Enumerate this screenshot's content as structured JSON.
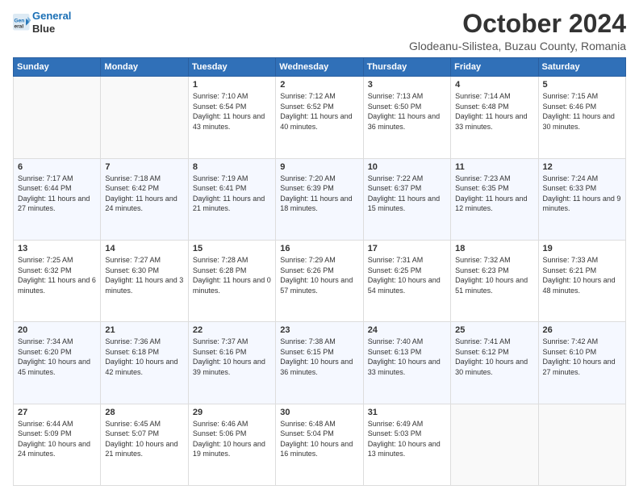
{
  "logo": {
    "line1": "General",
    "line2": "Blue"
  },
  "title": "October 2024",
  "location": "Glodeanu-Silistea, Buzau County, Romania",
  "days_of_week": [
    "Sunday",
    "Monday",
    "Tuesday",
    "Wednesday",
    "Thursday",
    "Friday",
    "Saturday"
  ],
  "weeks": [
    [
      {
        "day": "",
        "sunrise": "",
        "sunset": "",
        "daylight": ""
      },
      {
        "day": "",
        "sunrise": "",
        "sunset": "",
        "daylight": ""
      },
      {
        "day": "1",
        "sunrise": "Sunrise: 7:10 AM",
        "sunset": "Sunset: 6:54 PM",
        "daylight": "Daylight: 11 hours and 43 minutes."
      },
      {
        "day": "2",
        "sunrise": "Sunrise: 7:12 AM",
        "sunset": "Sunset: 6:52 PM",
        "daylight": "Daylight: 11 hours and 40 minutes."
      },
      {
        "day": "3",
        "sunrise": "Sunrise: 7:13 AM",
        "sunset": "Sunset: 6:50 PM",
        "daylight": "Daylight: 11 hours and 36 minutes."
      },
      {
        "day": "4",
        "sunrise": "Sunrise: 7:14 AM",
        "sunset": "Sunset: 6:48 PM",
        "daylight": "Daylight: 11 hours and 33 minutes."
      },
      {
        "day": "5",
        "sunrise": "Sunrise: 7:15 AM",
        "sunset": "Sunset: 6:46 PM",
        "daylight": "Daylight: 11 hours and 30 minutes."
      }
    ],
    [
      {
        "day": "6",
        "sunrise": "Sunrise: 7:17 AM",
        "sunset": "Sunset: 6:44 PM",
        "daylight": "Daylight: 11 hours and 27 minutes."
      },
      {
        "day": "7",
        "sunrise": "Sunrise: 7:18 AM",
        "sunset": "Sunset: 6:42 PM",
        "daylight": "Daylight: 11 hours and 24 minutes."
      },
      {
        "day": "8",
        "sunrise": "Sunrise: 7:19 AM",
        "sunset": "Sunset: 6:41 PM",
        "daylight": "Daylight: 11 hours and 21 minutes."
      },
      {
        "day": "9",
        "sunrise": "Sunrise: 7:20 AM",
        "sunset": "Sunset: 6:39 PM",
        "daylight": "Daylight: 11 hours and 18 minutes."
      },
      {
        "day": "10",
        "sunrise": "Sunrise: 7:22 AM",
        "sunset": "Sunset: 6:37 PM",
        "daylight": "Daylight: 11 hours and 15 minutes."
      },
      {
        "day": "11",
        "sunrise": "Sunrise: 7:23 AM",
        "sunset": "Sunset: 6:35 PM",
        "daylight": "Daylight: 11 hours and 12 minutes."
      },
      {
        "day": "12",
        "sunrise": "Sunrise: 7:24 AM",
        "sunset": "Sunset: 6:33 PM",
        "daylight": "Daylight: 11 hours and 9 minutes."
      }
    ],
    [
      {
        "day": "13",
        "sunrise": "Sunrise: 7:25 AM",
        "sunset": "Sunset: 6:32 PM",
        "daylight": "Daylight: 11 hours and 6 minutes."
      },
      {
        "day": "14",
        "sunrise": "Sunrise: 7:27 AM",
        "sunset": "Sunset: 6:30 PM",
        "daylight": "Daylight: 11 hours and 3 minutes."
      },
      {
        "day": "15",
        "sunrise": "Sunrise: 7:28 AM",
        "sunset": "Sunset: 6:28 PM",
        "daylight": "Daylight: 11 hours and 0 minutes."
      },
      {
        "day": "16",
        "sunrise": "Sunrise: 7:29 AM",
        "sunset": "Sunset: 6:26 PM",
        "daylight": "Daylight: 10 hours and 57 minutes."
      },
      {
        "day": "17",
        "sunrise": "Sunrise: 7:31 AM",
        "sunset": "Sunset: 6:25 PM",
        "daylight": "Daylight: 10 hours and 54 minutes."
      },
      {
        "day": "18",
        "sunrise": "Sunrise: 7:32 AM",
        "sunset": "Sunset: 6:23 PM",
        "daylight": "Daylight: 10 hours and 51 minutes."
      },
      {
        "day": "19",
        "sunrise": "Sunrise: 7:33 AM",
        "sunset": "Sunset: 6:21 PM",
        "daylight": "Daylight: 10 hours and 48 minutes."
      }
    ],
    [
      {
        "day": "20",
        "sunrise": "Sunrise: 7:34 AM",
        "sunset": "Sunset: 6:20 PM",
        "daylight": "Daylight: 10 hours and 45 minutes."
      },
      {
        "day": "21",
        "sunrise": "Sunrise: 7:36 AM",
        "sunset": "Sunset: 6:18 PM",
        "daylight": "Daylight: 10 hours and 42 minutes."
      },
      {
        "day": "22",
        "sunrise": "Sunrise: 7:37 AM",
        "sunset": "Sunset: 6:16 PM",
        "daylight": "Daylight: 10 hours and 39 minutes."
      },
      {
        "day": "23",
        "sunrise": "Sunrise: 7:38 AM",
        "sunset": "Sunset: 6:15 PM",
        "daylight": "Daylight: 10 hours and 36 minutes."
      },
      {
        "day": "24",
        "sunrise": "Sunrise: 7:40 AM",
        "sunset": "Sunset: 6:13 PM",
        "daylight": "Daylight: 10 hours and 33 minutes."
      },
      {
        "day": "25",
        "sunrise": "Sunrise: 7:41 AM",
        "sunset": "Sunset: 6:12 PM",
        "daylight": "Daylight: 10 hours and 30 minutes."
      },
      {
        "day": "26",
        "sunrise": "Sunrise: 7:42 AM",
        "sunset": "Sunset: 6:10 PM",
        "daylight": "Daylight: 10 hours and 27 minutes."
      }
    ],
    [
      {
        "day": "27",
        "sunrise": "Sunrise: 6:44 AM",
        "sunset": "Sunset: 5:09 PM",
        "daylight": "Daylight: 10 hours and 24 minutes."
      },
      {
        "day": "28",
        "sunrise": "Sunrise: 6:45 AM",
        "sunset": "Sunset: 5:07 PM",
        "daylight": "Daylight: 10 hours and 21 minutes."
      },
      {
        "day": "29",
        "sunrise": "Sunrise: 6:46 AM",
        "sunset": "Sunset: 5:06 PM",
        "daylight": "Daylight: 10 hours and 19 minutes."
      },
      {
        "day": "30",
        "sunrise": "Sunrise: 6:48 AM",
        "sunset": "Sunset: 5:04 PM",
        "daylight": "Daylight: 10 hours and 16 minutes."
      },
      {
        "day": "31",
        "sunrise": "Sunrise: 6:49 AM",
        "sunset": "Sunset: 5:03 PM",
        "daylight": "Daylight: 10 hours and 13 minutes."
      },
      {
        "day": "",
        "sunrise": "",
        "sunset": "",
        "daylight": ""
      },
      {
        "day": "",
        "sunrise": "",
        "sunset": "",
        "daylight": ""
      }
    ]
  ]
}
